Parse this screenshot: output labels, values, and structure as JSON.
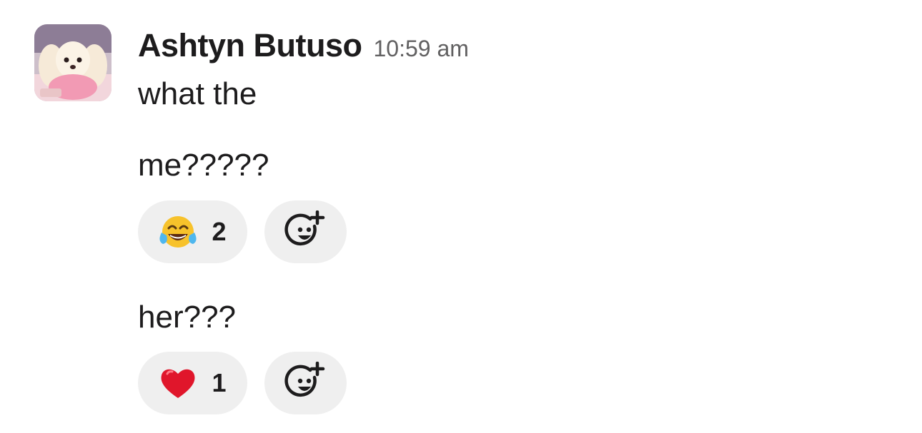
{
  "message": {
    "sender": "Ashtyn Butuso",
    "timestamp": "10:59 am",
    "avatar_icon": "dog-photo-avatar",
    "lines": [
      "what the",
      "me?????",
      "her???"
    ]
  },
  "reactions": [
    {
      "emoji": "face-with-tears-of-joy",
      "count": "2"
    },
    {
      "emoji": "red-heart",
      "count": "1"
    }
  ],
  "add_reaction_icon": "add-reaction-icon",
  "colors": {
    "pill_bg": "#efefef",
    "text": "#1d1c1d",
    "timestamp": "#616061",
    "heart": "#e0162b",
    "emoji_face": "#f7c22b"
  }
}
